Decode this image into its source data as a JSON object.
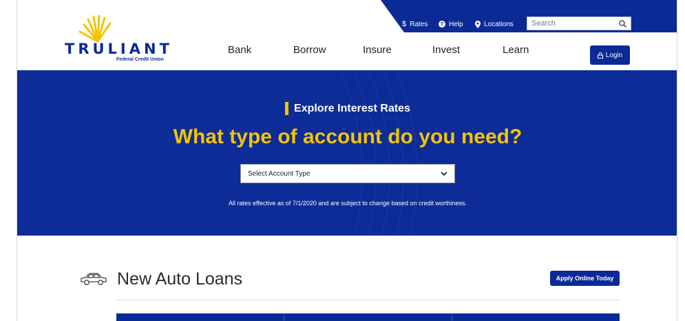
{
  "utility": {
    "rates_label": "Rates",
    "help_label": "Help",
    "locations_label": "Locations",
    "search_placeholder": "Search"
  },
  "logo": {
    "name": "TRULIANT",
    "subtitle": "Federal Credit Union"
  },
  "nav": {
    "items": [
      "Bank",
      "Borrow",
      "Insure",
      "Invest",
      "Learn"
    ],
    "login_label": "Login"
  },
  "hero": {
    "eyebrow": "Explore Interest Rates",
    "headline": "What type of account do you need?",
    "select_value": "Select Account Type",
    "disclaimer": "All rates effective as of 7/1/2020 and are subject to change based on credit worthiness."
  },
  "section": {
    "title": "New Auto Loans",
    "apply_label": "Apply Online Today"
  },
  "colors": {
    "brand_blue": "#0b2a96",
    "accent_yellow": "#f5c400"
  },
  "icons": [
    "dollar-icon",
    "help-icon",
    "location-pin-icon",
    "search-icon",
    "lock-icon",
    "chevron-down-icon",
    "car-icon",
    "sun-logo-icon"
  ]
}
